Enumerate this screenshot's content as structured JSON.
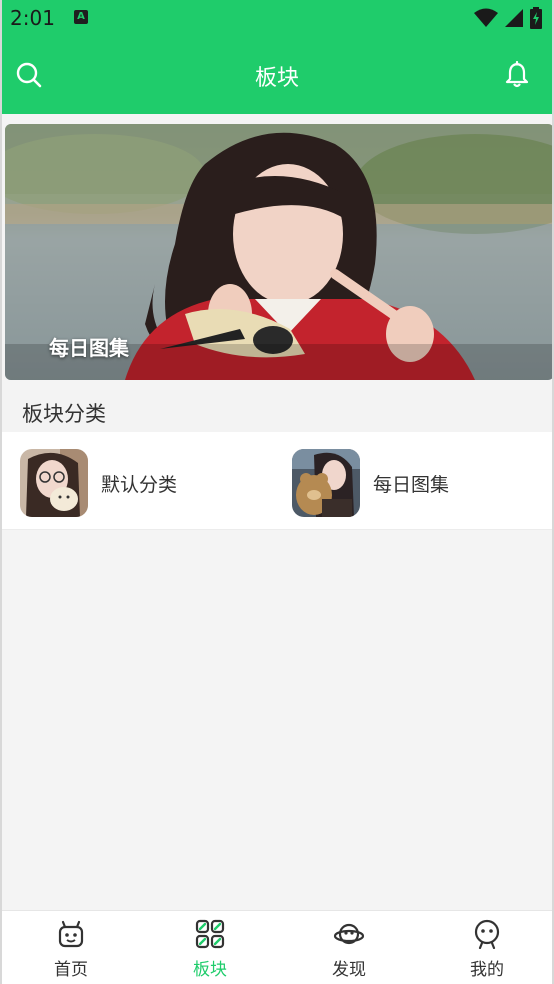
{
  "status_bar": {
    "time": "2:01",
    "notification_icon": "A"
  },
  "app_bar": {
    "title": "板块",
    "search_icon": "search-icon",
    "bell_icon": "bell-icon"
  },
  "banner": {
    "caption": "每日图集"
  },
  "section": {
    "title": "板块分类"
  },
  "categories": [
    {
      "label": "默认分类"
    },
    {
      "label": "每日图集"
    }
  ],
  "bottom_nav": [
    {
      "label": "首页",
      "icon": "robot-home-icon",
      "active": false
    },
    {
      "label": "板块",
      "icon": "grid-blocks-icon",
      "active": true
    },
    {
      "label": "发现",
      "icon": "planet-icon",
      "active": false
    },
    {
      "label": "我的",
      "icon": "face-icon",
      "active": false
    }
  ],
  "colors": {
    "accent": "#1fcc6b",
    "text": "#333333"
  }
}
